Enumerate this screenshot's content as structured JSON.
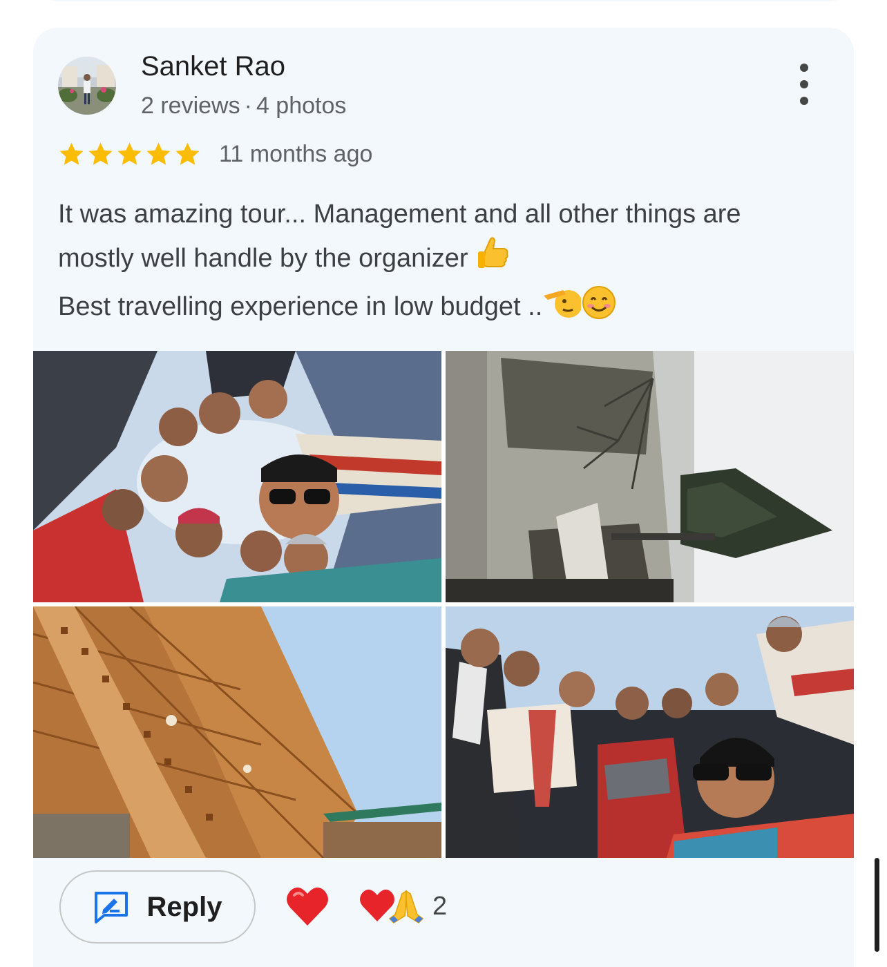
{
  "review": {
    "author": {
      "name": "Sanket Rao",
      "review_count": "2 reviews",
      "separator": "·",
      "photo_count": "4 photos"
    },
    "rating": 5,
    "rating_max": 5,
    "date": "11 months ago",
    "text_line1": "It was amazing tour... Management and all other things are",
    "text_line2": "mostly well handle by the organizer",
    "text_line3": "Best travelling experience in low budget ..",
    "photos": [
      {
        "icon": "group-selfie-photo"
      },
      {
        "icon": "foggy-trees-photo"
      },
      {
        "icon": "wooden-roof-photo"
      },
      {
        "icon": "group-winter-photo"
      }
    ],
    "actions": {
      "reply_label": "Reply",
      "reaction_heart": "heart-reaction-icon",
      "reaction_count": "2"
    }
  },
  "colors": {
    "card_background": "#f3f8fd",
    "star": "#fbbc04",
    "reply_icon": "#1a73e8",
    "heart": "#e8242b"
  }
}
